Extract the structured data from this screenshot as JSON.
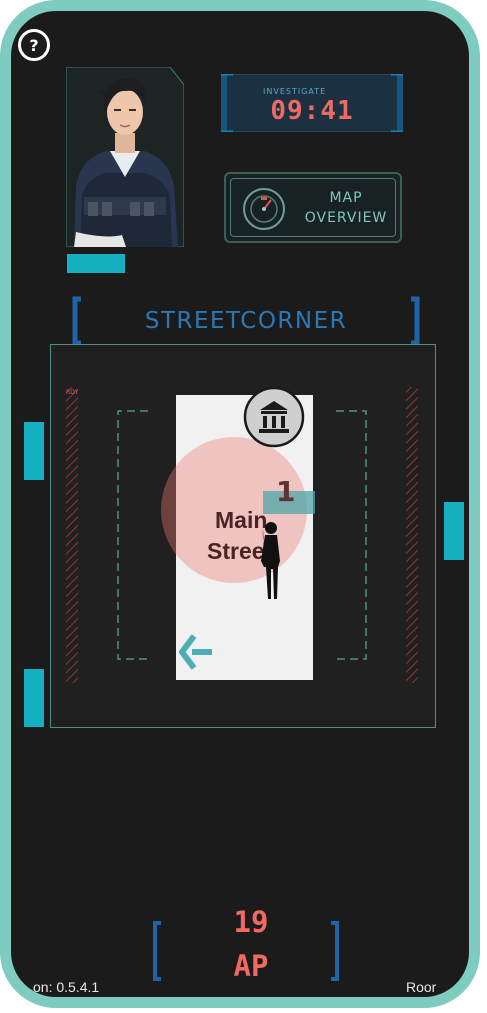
{
  "help": {
    "label": "?"
  },
  "timer": {
    "caption": "INVESTIGATE",
    "value": "09:41"
  },
  "map_button": {
    "line1": "MAP",
    "line2": "OVERVIEW"
  },
  "location": {
    "title": "STREETCORNER"
  },
  "board": {
    "ready_tag": "RDY",
    "room": {
      "name_line1": "Main",
      "name_line2": "Stree",
      "occupant_count": "1"
    }
  },
  "action_points": {
    "value": "19",
    "unit": "AP"
  },
  "footer": {
    "left": "on: 0.5.4.1",
    "right": "Roor"
  },
  "colors": {
    "frame": "#7ecbbf",
    "accent_cyan": "#17b0c3",
    "accent_red": "#f06a62",
    "accent_blue": "#2979b8"
  },
  "icons": [
    "help-icon",
    "compass-icon",
    "museum-icon",
    "back-arrow-icon",
    "person-silhouette-icon"
  ]
}
